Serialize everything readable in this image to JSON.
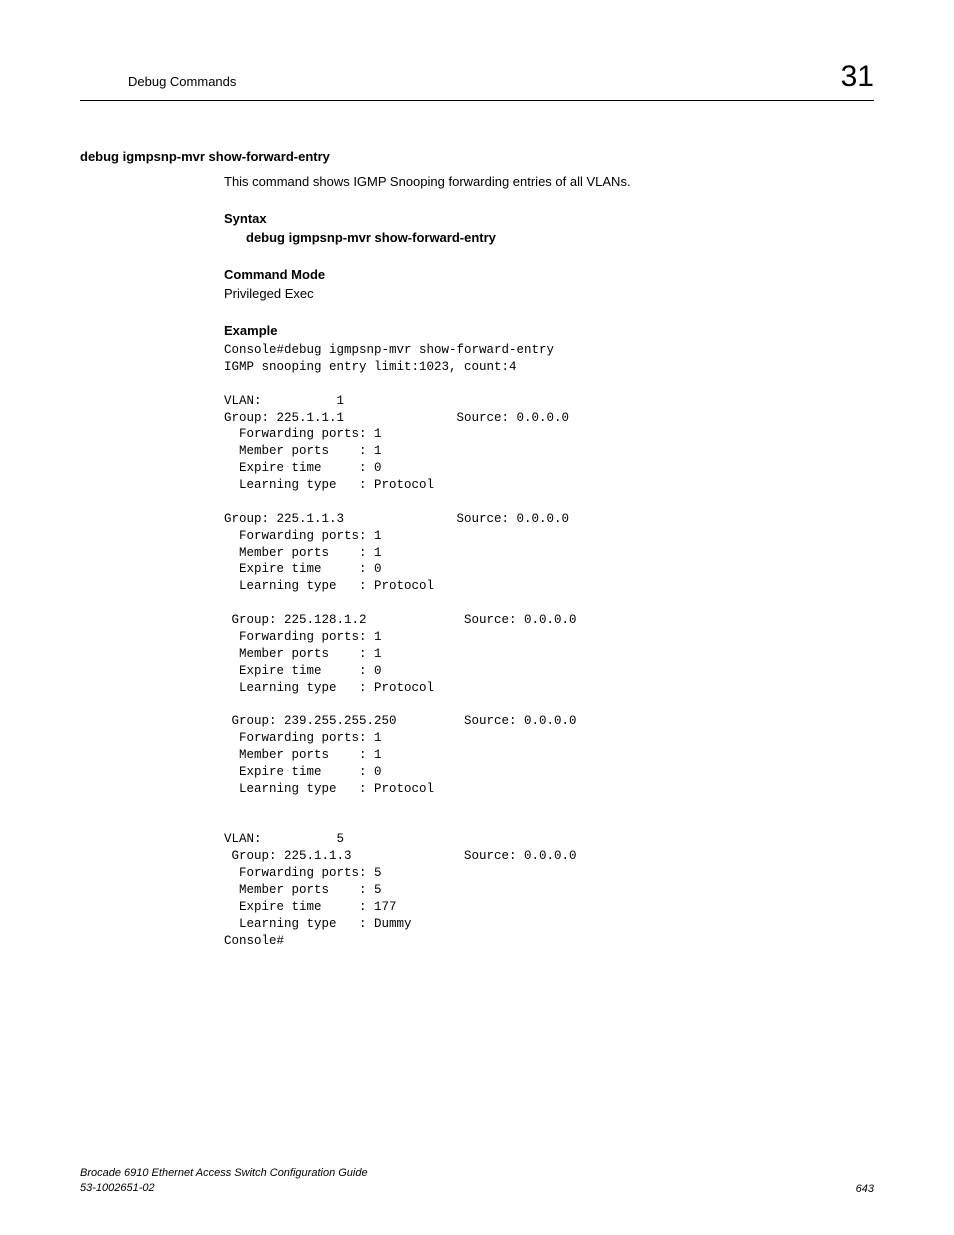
{
  "header": {
    "title": "Debug Commands",
    "chapter": "31"
  },
  "section": {
    "title": "debug igmpsnp-mvr show-forward-entry",
    "description": "This command shows IGMP Snooping forwarding entries of all VLANs.",
    "syntax_heading": "Syntax",
    "syntax_command": "debug igmpsnp-mvr show-forward-entry",
    "mode_heading": "Command Mode",
    "mode_text": "Privileged Exec",
    "example_heading": "Example",
    "example_code": "Console#debug igmpsnp-mvr show-forward-entry\nIGMP snooping entry limit:1023, count:4\n\nVLAN:          1\nGroup: 225.1.1.1               Source: 0.0.0.0\n  Forwarding ports: 1\n  Member ports    : 1\n  Expire time     : 0\n  Learning type   : Protocol\n\nGroup: 225.1.1.3               Source: 0.0.0.0\n  Forwarding ports: 1\n  Member ports    : 1\n  Expire time     : 0\n  Learning type   : Protocol\n\n Group: 225.128.1.2             Source: 0.0.0.0\n  Forwarding ports: 1\n  Member ports    : 1\n  Expire time     : 0\n  Learning type   : Protocol\n\n Group: 239.255.255.250         Source: 0.0.0.0\n  Forwarding ports: 1\n  Member ports    : 1\n  Expire time     : 0\n  Learning type   : Protocol\n\n\nVLAN:          5\n Group: 225.1.1.3               Source: 0.0.0.0\n  Forwarding ports: 5\n  Member ports    : 5\n  Expire time     : 177\n  Learning type   : Dummy\nConsole#"
  },
  "footer": {
    "guide_title": "Brocade 6910 Ethernet Access Switch Configuration Guide",
    "doc_number": "53-1002651-02",
    "page_number": "643"
  }
}
